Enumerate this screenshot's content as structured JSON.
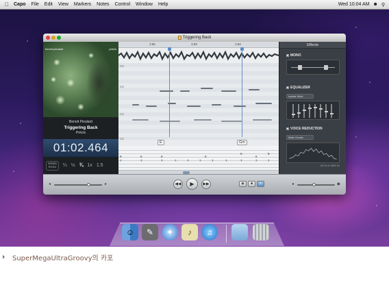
{
  "menubar": {
    "app": "Capo",
    "items": [
      "File",
      "Edit",
      "View",
      "Markers",
      "Notes",
      "Control",
      "Window",
      "Help"
    ],
    "clock": "Wed 10:04 AM"
  },
  "window": {
    "title": "Triggering Back"
  },
  "artwork": {
    "small_left": "benoit pioulard",
    "small_right": "précis"
  },
  "track": {
    "artist": "Benoit Pioulard",
    "title": "Triggering Back",
    "album": "Précis",
    "time": "01:02.464"
  },
  "speed": {
    "speed_label": "SPEED",
    "pitch_label": "PITCH",
    "options": [
      "¼",
      "½",
      "¾",
      "1x",
      "1.5"
    ],
    "selected": "¾"
  },
  "timeline": {
    "ticks": [
      "1:02",
      "1:03",
      "1:04"
    ]
  },
  "octaves": [
    "C5",
    "C4",
    "C3",
    "C2"
  ],
  "chords": [
    "E",
    "Gm"
  ],
  "tab_rows": [
    [
      "9",
      "6",
      "8",
      "",
      "6",
      "",
      "8",
      "6",
      "",
      "8"
    ],
    [
      "7",
      "7",
      "7",
      "7",
      "7",
      "7",
      "7",
      "7",
      "7",
      "7",
      "7",
      "7"
    ]
  ],
  "effects": {
    "title": "Effects",
    "mono_label": "MONO",
    "eq_label": "EQUALIZER",
    "eq_preset": "Isolate Mids",
    "vr_label": "VOICE REDUCTION",
    "vr_preset": "Male Vocals",
    "vr_range": "120 Hz to 3800 Hz"
  },
  "transport": {
    "rewind": "◀◀",
    "play": "▶",
    "forward": "▶▶"
  },
  "dock": {
    "icons": [
      "finder-icon",
      "preview-icon",
      "safari-icon",
      "capo-icon",
      "itunes-icon",
      "folder-icon",
      "trash-icon"
    ]
  },
  "caption": "SuperMegaUltraGroovy의 카포"
}
